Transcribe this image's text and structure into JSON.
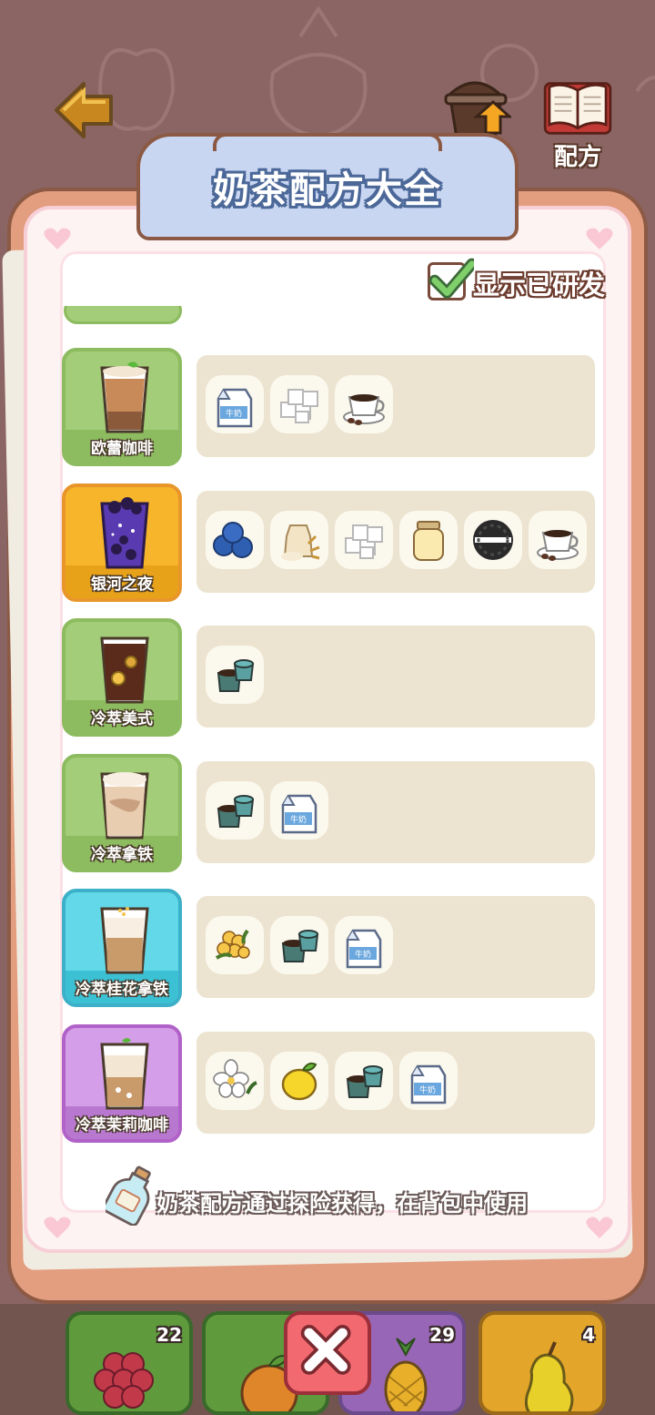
{
  "header": {
    "upgrade_label": "升级",
    "recipe_label": "配方"
  },
  "panel": {
    "title": "奶茶配方大全",
    "show_developed_label": "显示已研发",
    "show_developed_checked": true,
    "footer_note": "奶茶配方通过探险获得，在背包中使用"
  },
  "recipes": [
    {
      "name": "欧蕾咖啡",
      "card_color": "#a3cd78",
      "ingredients": [
        "milk-carton-icon",
        "sugar-cubes-icon",
        "coffee-cup-icon"
      ]
    },
    {
      "name": "银河之夜",
      "card_color": "#f7b52c",
      "ingredients": [
        "blueberries-icon",
        "flour-sack-icon",
        "sugar-cubes-icon",
        "condensed-milk-jar-icon",
        "oreo-cookie-icon",
        "coffee-cup-icon"
      ]
    },
    {
      "name": "冷萃美式",
      "card_color": "#a3cd78",
      "ingredients": [
        "coffee-capsules-icon"
      ]
    },
    {
      "name": "冷萃拿铁",
      "card_color": "#a3cd78",
      "ingredients": [
        "coffee-capsules-icon",
        "milk-carton-icon"
      ]
    },
    {
      "name": "冷萃桂花拿铁",
      "card_color": "#62d8e8",
      "ingredients": [
        "osmanthus-flower-icon",
        "coffee-capsules-icon",
        "milk-carton-icon"
      ]
    },
    {
      "name": "冷萃茉莉咖啡",
      "card_color": "#d59ee8",
      "ingredients": [
        "jasmine-flower-icon",
        "lemon-icon",
        "coffee-capsules-icon",
        "milk-carton-icon"
      ]
    }
  ],
  "bottom_slots": [
    {
      "item": "raspberry-icon",
      "count": "22",
      "color": "#5f9a3c"
    },
    {
      "item": "orange-icon",
      "count": "",
      "color": "#5f9a3c"
    },
    {
      "item": "pineapple-icon",
      "count": "29",
      "color": "#9866b6"
    },
    {
      "item": "pear-icon",
      "count": "4",
      "color": "#e3a62a"
    }
  ]
}
